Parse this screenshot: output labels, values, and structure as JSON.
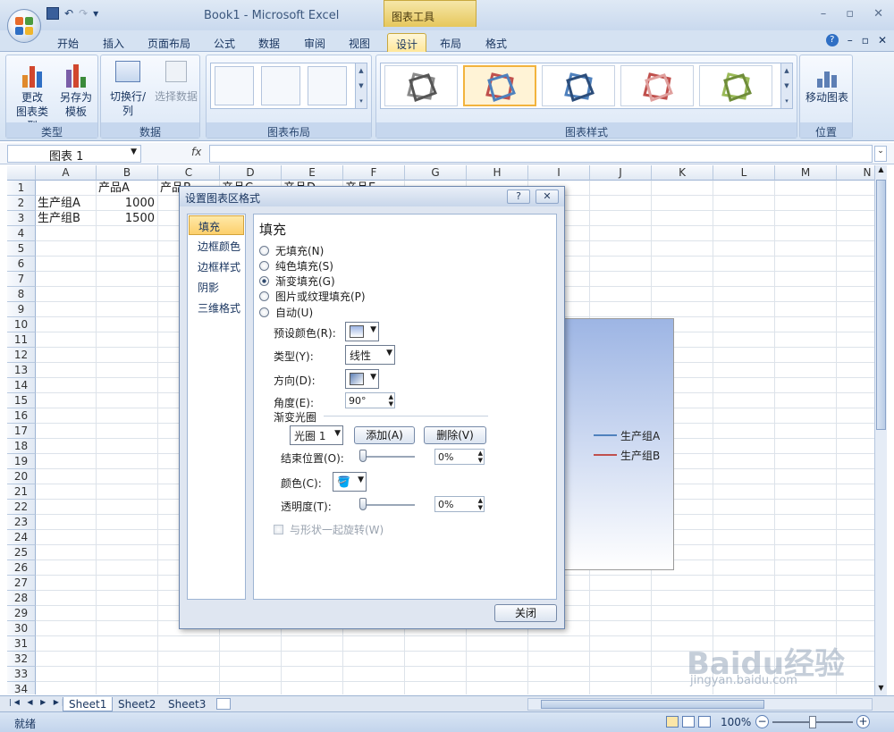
{
  "window": {
    "title": "Book1 - Microsoft Excel",
    "tools_label": "图表工具",
    "ctrl_min": "–",
    "ctrl_max": "▫",
    "ctrl_close": "✕"
  },
  "qat": {
    "save_icon": "save-icon",
    "undo": "↶",
    "redo": "↷",
    "more": "▾"
  },
  "tabs": [
    {
      "label": "开始"
    },
    {
      "label": "插入"
    },
    {
      "label": "页面布局"
    },
    {
      "label": "公式"
    },
    {
      "label": "数据"
    },
    {
      "label": "审阅"
    },
    {
      "label": "视图"
    },
    {
      "label": "设计"
    },
    {
      "label": "布局"
    },
    {
      "label": "格式"
    }
  ],
  "ribbon": {
    "type_group": {
      "label": "类型",
      "change_type_1": "更改",
      "change_type_2": "图表类型",
      "save_template_1": "另存为",
      "save_template_2": "模板"
    },
    "data_group": {
      "label": "数据",
      "switch": "切换行/列",
      "select_data": "选择数据"
    },
    "layout_group": {
      "label": "图表布局"
    },
    "style_group": {
      "label": "图表样式",
      "style_colors": [
        "#8a8a8a",
        "#c0504d",
        "#4f81bd",
        "#c0504d",
        "#9bbb59"
      ]
    },
    "location_group": {
      "label": "位置",
      "move_chart": "移动图表"
    }
  },
  "formula_bar": {
    "name_box": "图表 1",
    "fx": "fx",
    "value": ""
  },
  "columns": [
    "A",
    "B",
    "C",
    "D",
    "E",
    "F",
    "G",
    "H",
    "I",
    "J",
    "K",
    "L",
    "M",
    "N"
  ],
  "rows": [
    "1",
    "2",
    "3",
    "4",
    "5",
    "6",
    "7",
    "8",
    "9",
    "10",
    "11",
    "12",
    "13",
    "14",
    "15",
    "16",
    "17",
    "18",
    "19",
    "20",
    "21",
    "22",
    "23",
    "24",
    "25",
    "26",
    "27",
    "28",
    "29",
    "30",
    "31",
    "32",
    "33",
    "34"
  ],
  "cells": {
    "B1": "产品A",
    "C1": "产品B",
    "D1": "产品C",
    "E1": "产品D",
    "F1": "产品E",
    "A2": "生产组A",
    "B2": "1000",
    "A3": "生产组B",
    "B3": "1500"
  },
  "chart": {
    "legend": [
      {
        "name": "生产组A",
        "color": "#4f81bd"
      },
      {
        "name": "生产组B",
        "color": "#c0504d"
      }
    ]
  },
  "dialog": {
    "title": "设置图表区格式",
    "help": "?",
    "close_icon": "✕",
    "nav": [
      "填充",
      "边框颜色",
      "边框样式",
      "阴影",
      "三维格式"
    ],
    "section_title": "填充",
    "options": [
      "无填充(N)",
      "纯色填充(S)",
      "渐变填充(G)",
      "图片或纹理填充(P)",
      "自动(U)"
    ],
    "selected_option": "渐变填充(G)",
    "preset_label": "预设颜色(R):",
    "type_label": "类型(Y):",
    "type_value": "线性",
    "direction_label": "方向(D):",
    "angle_label": "角度(E):",
    "angle_value": "90°",
    "stops_heading": "渐变光圈",
    "stop_select": "光圈 1",
    "add_button": "添加(A)",
    "delete_button": "删除(V)",
    "end_position_label": "结束位置(O):",
    "end_position_value": "0%",
    "color_label": "颜色(C):",
    "transparency_label": "透明度(T):",
    "transparency_value": "0%",
    "rotate_label": "与形状一起旋转(W)",
    "close_button": "关闭"
  },
  "sheets": [
    "Sheet1",
    "Sheet2",
    "Sheet3"
  ],
  "status": {
    "ready": "就绪",
    "zoom": "100%",
    "zoom_fraction": 0.5
  },
  "watermark": {
    "brand": "Baidu经验",
    "url": "jingyan.baidu.com"
  }
}
